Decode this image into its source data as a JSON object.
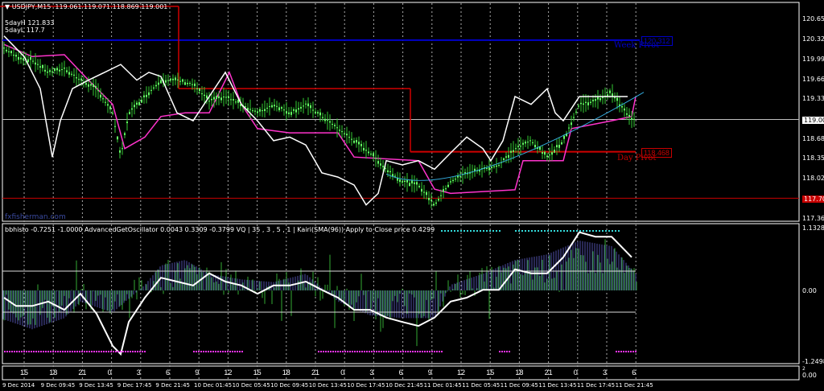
{
  "header": {
    "symbol": "USDJPY,M15",
    "ohlc": "119.061 119.071 118.869 119.001",
    "fiveday_high": "5dayH 121.833",
    "fiveday_low": "5dayL 117.7",
    "watermark": "fxfisherman.com"
  },
  "indicator_header": "bbhisto -0.7251 -1.0000  AdvancedGetOscillator 0.0043 0.3309 -0.3799  VQ |  35 , 3 , 5 , 1  |   Kairi(SMA(96)) Apply to Close price 0.4299",
  "levels": {
    "week_pivot": {
      "label": "Week Pivot",
      "value": "120.312",
      "price": 120.312,
      "color": "#0000c8"
    },
    "day_pivot": {
      "label": "Day Pivot",
      "value": "118.468",
      "price": 118.468,
      "color": "#c80000"
    },
    "low_line": {
      "value": "117.700",
      "price": 117.7,
      "color": "#c80000"
    },
    "current": {
      "value": "119.001",
      "price": 119.001
    }
  },
  "price_axis": [
    "120.655",
    "120.325",
    "119.995",
    "119.665",
    "119.335",
    "119.001",
    "118.680",
    "118.350",
    "118.020",
    "117.700",
    "117.360"
  ],
  "osc_axis": [
    "1.1328",
    "0.00",
    "-1.2498"
  ],
  "third_axis": [
    "2",
    "0.00"
  ],
  "hours": [
    "15",
    "18",
    "21",
    "0",
    "3",
    "6",
    "9",
    "12",
    "15",
    "18",
    "21",
    "0",
    "3",
    "6",
    "9",
    "12",
    "15",
    "18",
    "21",
    "0",
    "3",
    "6"
  ],
  "dates": [
    "9 Dec 2014",
    "9 Dec 09:45",
    "9 Dec 13:45",
    "9 Dec 17:45",
    "9 Dec 21:45",
    "10 Dec 01:45",
    "10 Dec 05:45",
    "10 Dec 09:45",
    "10 Dec 13:45",
    "10 Dec 17:45",
    "10 Dec 21:45",
    "11 Dec 01:45",
    "11 Dec 05:45",
    "11 Dec 09:45",
    "11 Dec 13:45",
    "11 Dec 17:45",
    "11 Dec 21:45"
  ],
  "chart_data": {
    "type": "line",
    "price_range": [
      117.36,
      120.655
    ],
    "osc_range": [
      -1.2498,
      1.1328
    ],
    "price_series": {
      "bar": [
        5,
        20,
        40,
        60,
        80,
        100,
        120,
        140,
        150,
        160,
        180,
        200,
        220,
        240,
        260,
        280,
        300,
        320,
        340,
        360,
        380,
        400,
        420,
        440,
        460,
        480,
        500,
        520,
        540,
        560,
        580,
        600,
        620,
        640,
        660,
        680,
        700,
        720,
        740,
        760,
        770,
        785
      ],
      "close": [
        120.18,
        120.04,
        119.98,
        119.78,
        119.84,
        119.65,
        119.51,
        119.11,
        118.38,
        119.11,
        119.38,
        119.65,
        119.65,
        119.58,
        119.31,
        119.38,
        119.25,
        119.11,
        119.25,
        119.11,
        119.25,
        119.05,
        118.85,
        118.65,
        118.45,
        118.18,
        117.98,
        117.92,
        117.59,
        117.98,
        118.12,
        118.18,
        118.25,
        118.52,
        118.65,
        118.38,
        118.65,
        119.25,
        119.31,
        119.45,
        119.25,
        119.0
      ]
    },
    "white_series": {
      "bar": [
        5,
        30,
        50,
        65,
        75,
        90,
        110,
        130,
        150,
        170,
        185,
        200,
        220,
        240,
        260,
        280,
        300,
        320,
        340,
        360,
        380,
        400,
        420,
        440,
        455,
        470,
        480,
        500,
        520,
        540,
        560,
        580,
        600,
        610,
        625,
        640,
        660,
        680,
        690,
        700,
        720,
        750,
        780
      ],
      "value": [
        120.38,
        120.04,
        119.51,
        118.38,
        118.98,
        119.51,
        119.65,
        119.78,
        119.91,
        119.65,
        119.78,
        119.71,
        119.11,
        118.98,
        119.38,
        119.78,
        119.25,
        118.98,
        118.65,
        118.71,
        118.58,
        118.12,
        118.05,
        117.92,
        117.59,
        117.78,
        118.32,
        118.25,
        118.32,
        118.18,
        118.45,
        118.71,
        118.52,
        118.32,
        118.65,
        119.38,
        119.25,
        119.51,
        119.11,
        118.98,
        119.38,
        119.38,
        119.38
      ]
    },
    "band_series": {
      "bar": [
        5,
        40,
        80,
        110,
        140,
        155,
        180,
        200,
        230,
        260,
        285,
        300,
        320,
        360,
        420,
        440,
        520,
        540,
        560,
        600,
        640,
        650,
        700,
        710,
        760,
        785,
        790
      ],
      "value": [
        120.24,
        120.04,
        120.07,
        119.65,
        119.25,
        118.52,
        118.71,
        119.05,
        119.11,
        119.11,
        119.78,
        119.25,
        118.85,
        118.78,
        118.78,
        118.38,
        118.32,
        117.85,
        117.78,
        117.81,
        117.84,
        118.32,
        118.32,
        118.85,
        118.98,
        119.05,
        119.38
      ]
    },
    "red_steps": [
      {
        "from": 0,
        "to": 222,
        "value": 120.87
      },
      {
        "from": 222,
        "to": 510,
        "value": 119.51
      },
      {
        "from": 510,
        "to": 790,
        "value": 118.468
      }
    ],
    "oscillator_line": {
      "bar": [
        5,
        20,
        40,
        60,
        80,
        100,
        120,
        140,
        150,
        160,
        180,
        200,
        220,
        240,
        260,
        280,
        300,
        320,
        340,
        360,
        380,
        400,
        420,
        440,
        460,
        480,
        500,
        520,
        540,
        560,
        580,
        600,
        620,
        640,
        660,
        680,
        700,
        720,
        740,
        760,
        785
      ],
      "value": [
        -0.13,
        -0.28,
        -0.28,
        -0.2,
        -0.35,
        -0.06,
        -0.42,
        -1.0,
        -1.15,
        -0.57,
        -0.13,
        0.23,
        0.16,
        0.09,
        0.31,
        0.16,
        0.09,
        -0.06,
        0.09,
        0.09,
        0.16,
        0.01,
        -0.13,
        -0.35,
        -0.35,
        -0.49,
        -0.57,
        -0.64,
        -0.49,
        -0.2,
        -0.13,
        0.01,
        0.01,
        0.38,
        0.31,
        0.31,
        0.6,
        1.05,
        0.97,
        0.97,
        0.6
      ]
    },
    "histogram": {
      "bar": [
        0,
        40,
        80,
        100,
        140,
        180,
        200,
        230,
        260,
        300,
        340,
        380,
        420,
        460,
        500,
        540,
        560,
        600,
        640,
        680,
        720,
        760,
        790
      ],
      "value": [
        -0.5,
        -0.7,
        -0.5,
        -0.2,
        -0.4,
        0.1,
        0.45,
        0.55,
        0.3,
        0.2,
        0.15,
        0.3,
        -0.2,
        -0.45,
        -0.5,
        -0.5,
        0.1,
        0.3,
        0.55,
        0.65,
        0.9,
        0.8,
        0.3
      ]
    },
    "cyan_dots": [
      [
        548,
        620
      ],
      [
        640,
        770
      ]
    ],
    "magenta_dots": [
      [
        5,
        180
      ],
      [
        240,
        300
      ],
      [
        395,
        550
      ],
      [
        620,
        632
      ],
      [
        765,
        790
      ]
    ]
  }
}
